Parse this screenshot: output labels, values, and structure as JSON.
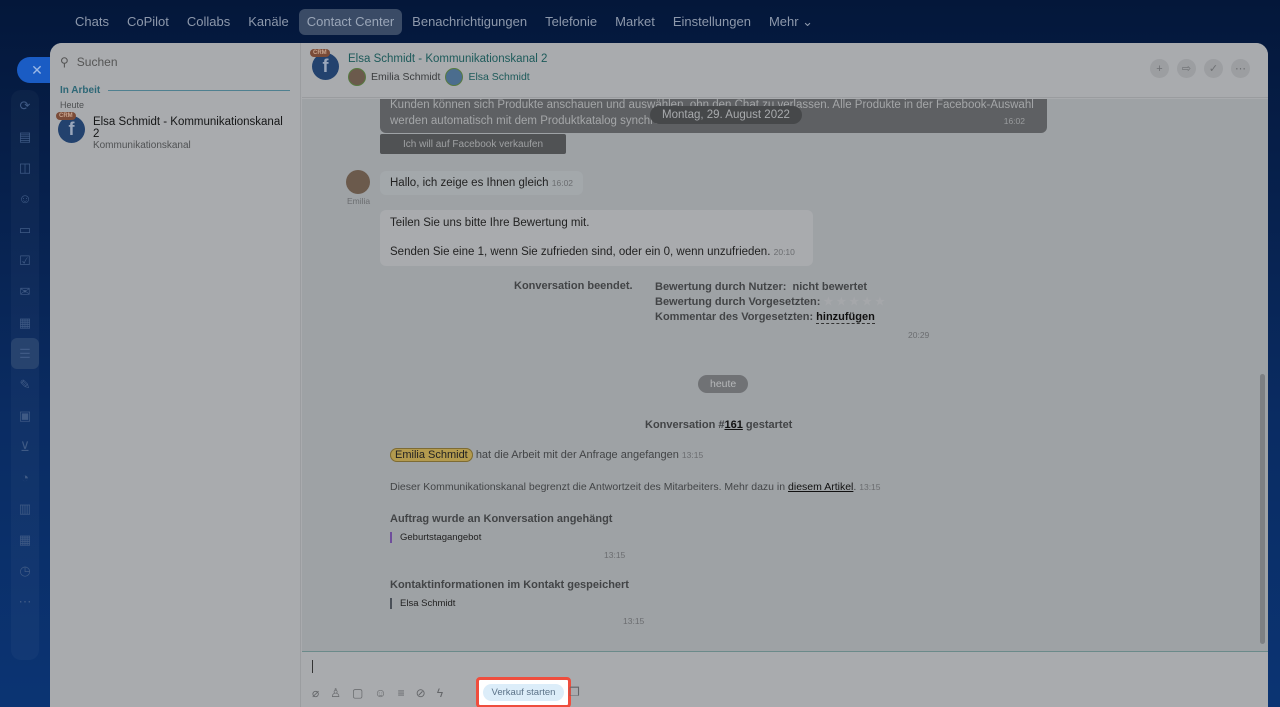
{
  "topnav": [
    "Chats",
    "CoPilot",
    "Collabs",
    "Kanäle",
    "Contact Center",
    "Benachrichtigungen",
    "Telefonie",
    "Market",
    "Einstellungen",
    "Mehr ⌄"
  ],
  "left": {
    "search_placeholder": "Suchen",
    "section": "In Arbeit",
    "group": "Heute",
    "chat": {
      "badge": "CRM",
      "title": "Elsa Schmidt - Kommunikationskanal 2",
      "subtitle": "Kommunikationskanal"
    }
  },
  "header": {
    "title": "Elsa Schmidt - Kommunikationskanal 2",
    "participants": [
      "Emilia Schmidt",
      "Elsa Schmidt"
    ]
  },
  "messages": {
    "fb_text": "Kunden können sich Produkte anschauen und auswählen, ohn den Chat zu verlassen. Alle Produkte in der Facebook-Auswahl werden automatisch mit dem Produktkatalog synchronisiert.",
    "fb_time": "16:02",
    "date_pill": "Montag, 29. August 2022",
    "fb_button": "Ich will auf Facebook verkaufen",
    "m1": "Hallo, ich zeige es Ihnen gleich",
    "m1_time": "16:02",
    "m1_author": "Emilia",
    "m2_line1": "Teilen Sie uns bitte Ihre Bewertung mit.",
    "m2_line2": "Senden Sie eine 1, wenn Sie zufrieden sind, oder ein 0, wenn unzufrieden.",
    "m2_time": "20:10",
    "ended": "Konversation beendet.",
    "rating_user_label": "Bewertung durch Nutzer:",
    "rating_user_value": "nicht bewertet",
    "rating_sup_label": "Bewertung durch Vorgesetzten:",
    "stars": "★★★★★",
    "comment_label": "Kommentar des Vorgesetzten:",
    "comment_link": "hinzufügen",
    "ended_time": "20:29",
    "today": "heute",
    "started_pre": "Konversation #",
    "started_num": "161",
    "started_post": " gestartet",
    "operator": "Emilia Schmidt",
    "operator_text": "hat die Arbeit mit der Anfrage angefangen",
    "operator_time": "13:15",
    "limit_text": "Dieser Kommunikationskanal begrenzt die Antwortzeit des Mitarbeiters. Mehr dazu in ",
    "limit_link": "diesem Artikel",
    "limit_time": "13:15",
    "order_title": "Auftrag wurde an Konversation angehängt",
    "order_item": "Geburtstagangebot",
    "order_time": "13:15",
    "contact_title": "Kontaktinformationen im Kontakt gespeichert",
    "contact_item": "Elsa Schmidt",
    "contact_time": "13:15"
  },
  "input": {
    "sale_button": "Verkauf starten"
  }
}
